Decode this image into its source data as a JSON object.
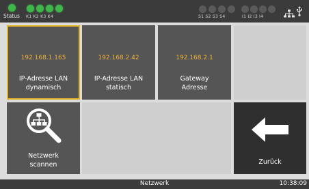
{
  "status": {
    "label": "Status",
    "k_labels": "K1  K2  K3  K4",
    "s_labels": "S1  S2  S3  S4",
    "i_labels": "I1   I2   I3   I4",
    "status_color": "#3fb64a",
    "k_color": "#3fb64a",
    "inactive_color": "#5a5a5a"
  },
  "tiles": [
    {
      "ip": "192.168.1.165",
      "label_line1": "IP-Adresse LAN",
      "label_line2": "dynamisch"
    },
    {
      "ip": "192.168.2.42",
      "label_line1": "IP-Adresse LAN",
      "label_line2": "statisch"
    },
    {
      "ip": "192.168.2.1",
      "label_line1": "Gateway",
      "label_line2": "Adresse"
    }
  ],
  "scan": {
    "label_line1": "Netzwerk",
    "label_line2": "scannen"
  },
  "back": {
    "label": "Zurück"
  },
  "footer": {
    "title": "Netzwerk",
    "time": "10:38:09"
  },
  "colors": {
    "selected_outline": "#e3b62a",
    "ip_text": "#f0b23a",
    "tile_bg": "#555555"
  },
  "icons": [
    "network-tree-icon",
    "usb-icon",
    "network-scan-icon",
    "arrow-left-icon"
  ]
}
